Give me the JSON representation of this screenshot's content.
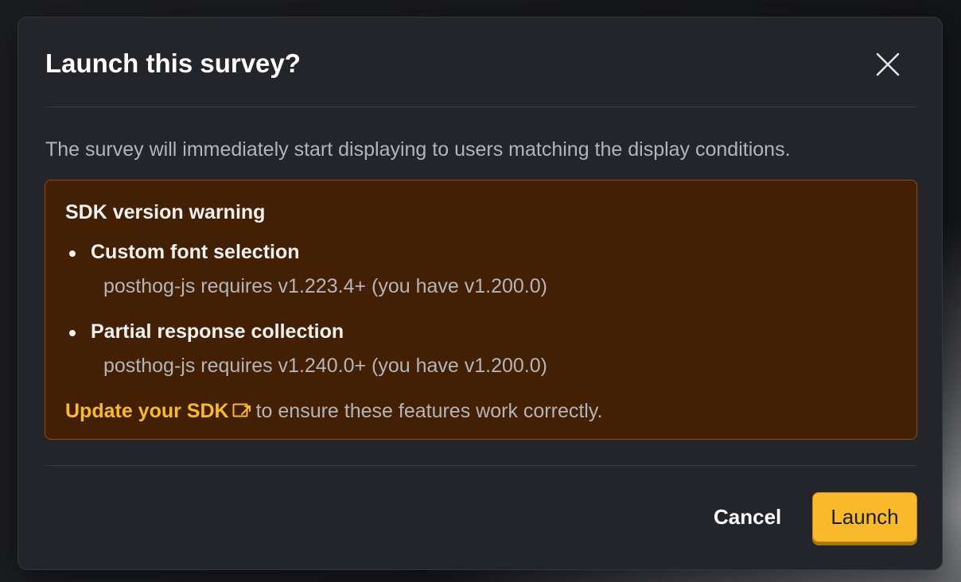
{
  "dialog": {
    "title": "Launch this survey?",
    "close_icon": "close-icon",
    "description": "The survey will immediately start displaying to users matching the display conditions."
  },
  "warning": {
    "title": "SDK version warning",
    "items": [
      {
        "feature": "Custom font selection",
        "requirement": "posthog-js requires v1.223.4+ (you have v1.200.0)"
      },
      {
        "feature": "Partial response collection",
        "requirement": "posthog-js requires v1.240.0+ (you have v1.200.0)"
      }
    ],
    "link_text": "Update your SDK",
    "link_icon": "external-link-icon",
    "link_suffix": "to ensure these features work correctly."
  },
  "footer": {
    "cancel_label": "Cancel",
    "launch_label": "Launch"
  },
  "colors": {
    "modal_bg": "#23252b",
    "warning_bg": "#432003",
    "warning_border": "#8a4c12",
    "accent": "#f8b92b",
    "muted_text": "#b3b5ba"
  }
}
